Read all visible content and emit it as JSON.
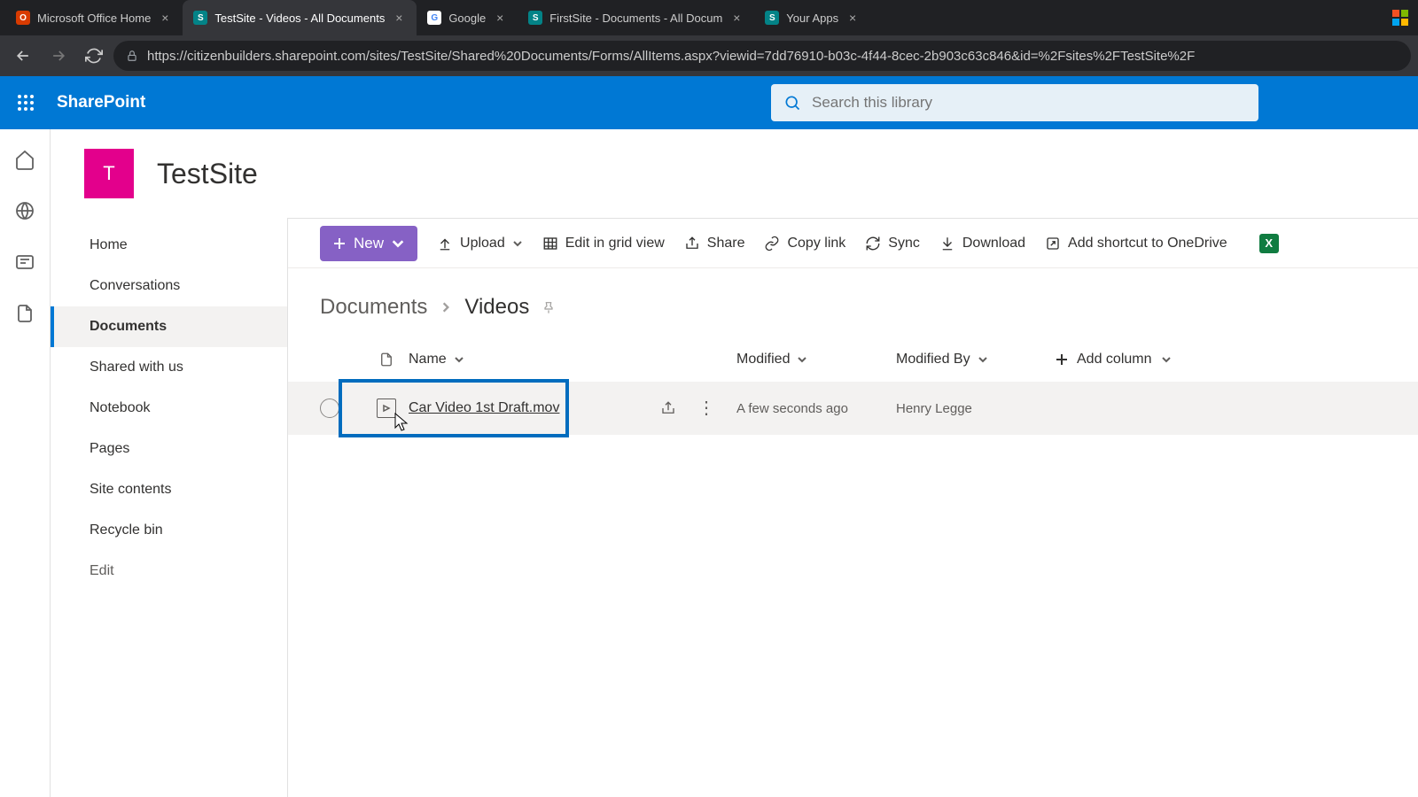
{
  "browser": {
    "tabs": [
      {
        "title": "Microsoft Office Home",
        "favicon_bg": "#d83b01",
        "favicon_letter": "O",
        "active": false
      },
      {
        "title": "TestSite - Videos - All Documents",
        "favicon_bg": "#038387",
        "favicon_letter": "S",
        "active": true
      },
      {
        "title": "Google",
        "favicon_bg": "#ffffff",
        "favicon_letter": "G",
        "active": false
      },
      {
        "title": "FirstSite - Documents - All Docum",
        "favicon_bg": "#038387",
        "favicon_letter": "S",
        "active": false
      },
      {
        "title": "Your Apps",
        "favicon_bg": "#038387",
        "favicon_letter": "S",
        "active": false
      }
    ],
    "url": "https://citizenbuilders.sharepoint.com/sites/TestSite/Shared%20Documents/Forms/AllItems.aspx?viewid=7dd76910-b03c-4f44-8cec-2b903c63c846&id=%2Fsites%2FTestSite%2F"
  },
  "suite": {
    "brand": "SharePoint",
    "search_placeholder": "Search this library"
  },
  "site": {
    "logo_letter": "T",
    "name": "TestSite"
  },
  "nav": {
    "items": [
      "Home",
      "Conversations",
      "Documents",
      "Shared with us",
      "Notebook",
      "Pages",
      "Site contents",
      "Recycle bin",
      "Edit"
    ],
    "selected_index": 2
  },
  "commands": {
    "new": "New",
    "upload": "Upload",
    "edit_grid": "Edit in grid view",
    "share": "Share",
    "copy_link": "Copy link",
    "sync": "Sync",
    "download": "Download",
    "shortcut": "Add shortcut to OneDrive"
  },
  "breadcrumb": {
    "parent": "Documents",
    "current": "Videos"
  },
  "columns": {
    "name": "Name",
    "modified": "Modified",
    "modified_by": "Modified By",
    "add": "Add column"
  },
  "rows": [
    {
      "name": "Car Video 1st Draft.mov",
      "modified": "A few seconds ago",
      "modified_by": "Henry Legge"
    }
  ]
}
